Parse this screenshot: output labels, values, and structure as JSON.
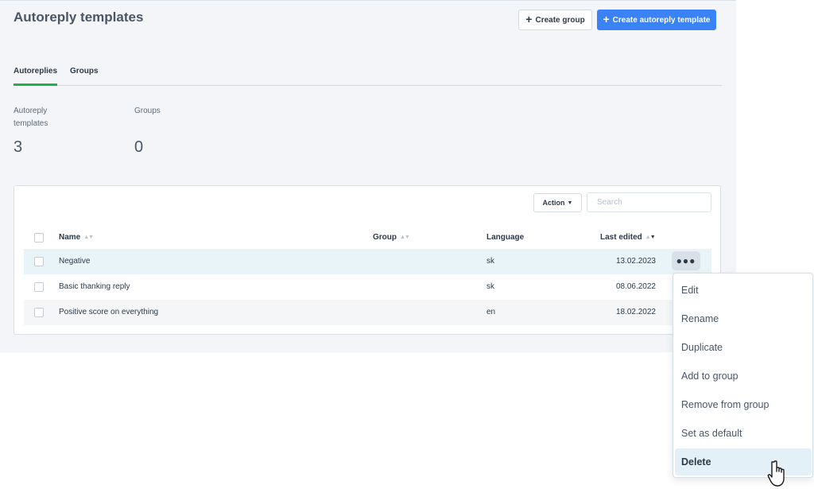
{
  "header": {
    "title": "Autoreply templates",
    "create_group_label": "Create group",
    "create_template_label": "Create autoreply template"
  },
  "tabs": [
    {
      "label": "Autoreplies",
      "active": true
    },
    {
      "label": "Groups",
      "active": false
    }
  ],
  "stats": [
    {
      "label": "Autoreply templates",
      "value": "3"
    },
    {
      "label": "Groups",
      "value": "0"
    }
  ],
  "toolbar": {
    "action_label": "Action",
    "search_placeholder": "Search"
  },
  "table": {
    "columns": [
      "Name",
      "Group",
      "Language",
      "Last edited"
    ],
    "rows": [
      {
        "name": "Negative",
        "group": "",
        "language": "sk",
        "last_edited": "13.02.2023"
      },
      {
        "name": "Basic thanking reply",
        "group": "",
        "language": "sk",
        "last_edited": "08.06.2022"
      },
      {
        "name": "Positive score on everything",
        "group": "",
        "language": "en",
        "last_edited": "18.02.2022"
      }
    ]
  },
  "context_menu": {
    "items": [
      "Edit",
      "Rename",
      "Duplicate",
      "Add to group",
      "Remove from group",
      "Set as default",
      "Delete"
    ],
    "highlighted": "Delete"
  },
  "colors": {
    "primary": "#3b82f6",
    "tab_active": "#22b04a",
    "panel_bg": "#f3f5f8",
    "row_highlight": "#e9f4f9"
  }
}
